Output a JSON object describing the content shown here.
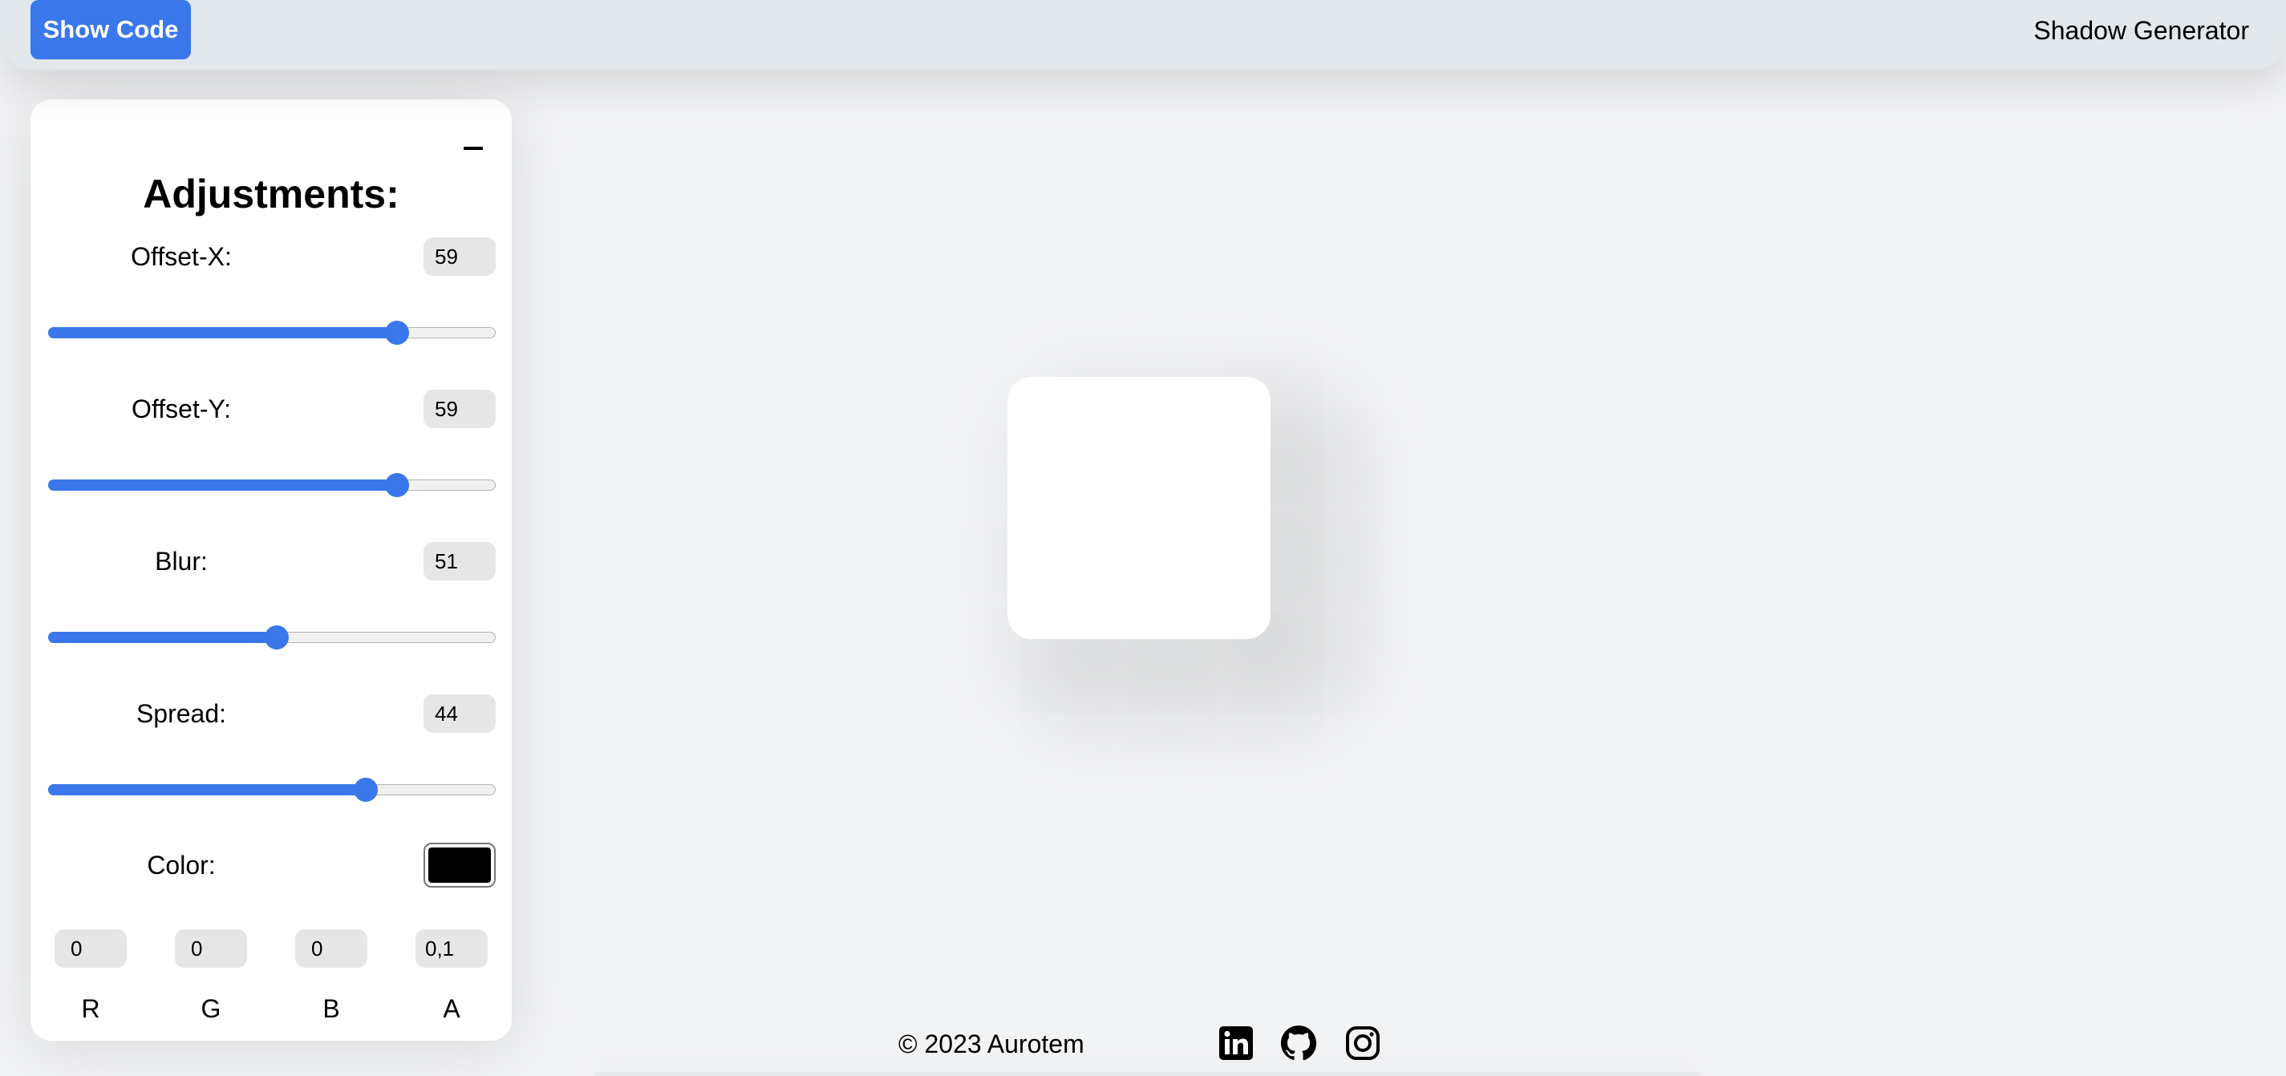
{
  "header": {
    "show_code_label": "Show Code",
    "title": "Shadow Generator"
  },
  "panel": {
    "title": "Adjustments:",
    "minimize_icon": "minus-icon",
    "controls": [
      {
        "label": "Offset-X:",
        "value": "59",
        "slider_fraction": 0.78
      },
      {
        "label": "Offset-Y:",
        "value": "59",
        "slider_fraction": 0.78
      },
      {
        "label": "Blur:",
        "value": "51",
        "slider_fraction": 0.51
      },
      {
        "label": "Spread:",
        "value": "44",
        "slider_fraction": 0.71
      }
    ],
    "color": {
      "label": "Color:",
      "value": "#000000"
    },
    "rgba": [
      {
        "label": "R",
        "value": "0"
      },
      {
        "label": "G",
        "value": "0"
      },
      {
        "label": "B",
        "value": "0"
      },
      {
        "label": "A",
        "value": "0,1"
      }
    ]
  },
  "accent_color": "#3a77ea",
  "footer": {
    "copyright": "© 2023 Aurotem",
    "icons": [
      "linkedin-icon",
      "github-icon",
      "instagram-icon"
    ]
  }
}
